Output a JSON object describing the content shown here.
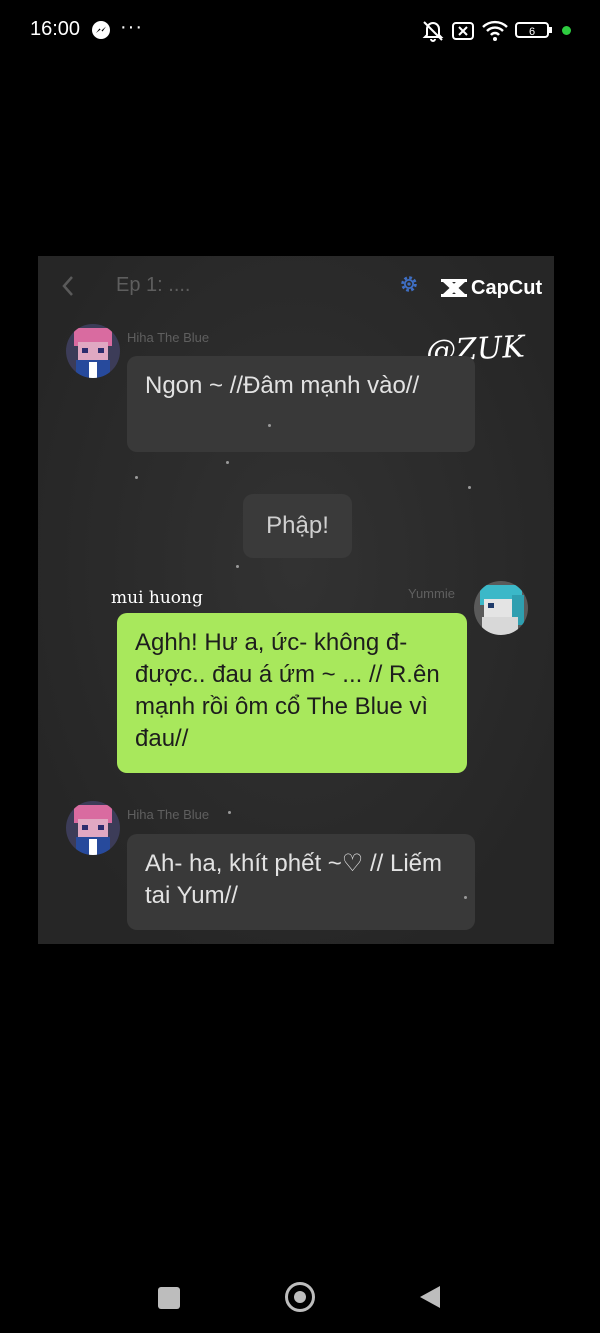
{
  "status_bar": {
    "time": "16:00",
    "more": "···",
    "battery": "6"
  },
  "chat": {
    "header_title": "Ep 1: ....",
    "capcut_label": "CapCut",
    "watermark": "@ZUK",
    "messages": [
      {
        "sender": "Hiha The Blue",
        "text": "Ngon ~ //Đâm mạnh vào//"
      },
      {
        "system": "Phập!"
      },
      {
        "sender": "Yummie",
        "nickname": "mui huong",
        "text": "Aghh! Hư a, ức- không đ- được.. đau á ứm ~ ... // R.ên mạnh rồi ôm cổ The Blue vì đau//"
      },
      {
        "sender": "Hiha The Blue",
        "text": "Ah- ha, khít phết ~♡ // Liếm tai Yum//"
      }
    ]
  },
  "colors": {
    "background": "#000000",
    "chat_bg": "#2b2b2b",
    "bubble_dark": "#393939",
    "bubble_green": "#a8e85c",
    "status_dot": "#2ecc40"
  }
}
